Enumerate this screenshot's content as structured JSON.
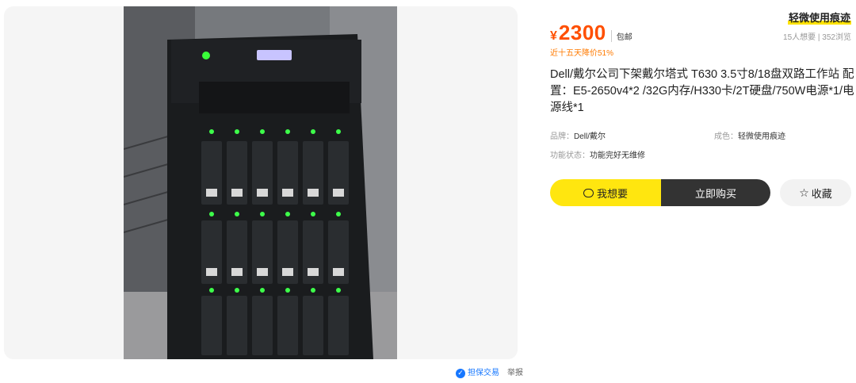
{
  "gallery": {
    "image": "server-tower-photo"
  },
  "footer": {
    "guarantee": "担保交易",
    "report": "举报"
  },
  "product": {
    "currency": "¥",
    "price": "2300",
    "shipping": "包邮",
    "price_drop": "近十五天降价51%",
    "condition": "轻微使用痕迹",
    "stats": "15人想要 | 352浏览",
    "title": "Dell/戴尔公司下架戴尔塔式 T630 3.5寸8/18盘双路工作站 配置：E5-2650v4*2 /32G内存/H330卡/2T硬盘/750W电源*1/电源线*1"
  },
  "attrs": {
    "brand_label": "品牌：",
    "brand_value": "Dell/戴尔",
    "cond_label": "成色：",
    "cond_value": "轻微使用痕迹",
    "func_label": "功能状态：",
    "func_value": "功能完好无维修"
  },
  "buttons": {
    "want": "我想要",
    "buy": "立即购买",
    "fav": "收藏"
  },
  "colors": {
    "accent": "#ff4f00",
    "yellow": "#ffe60f",
    "dark": "#333333"
  }
}
